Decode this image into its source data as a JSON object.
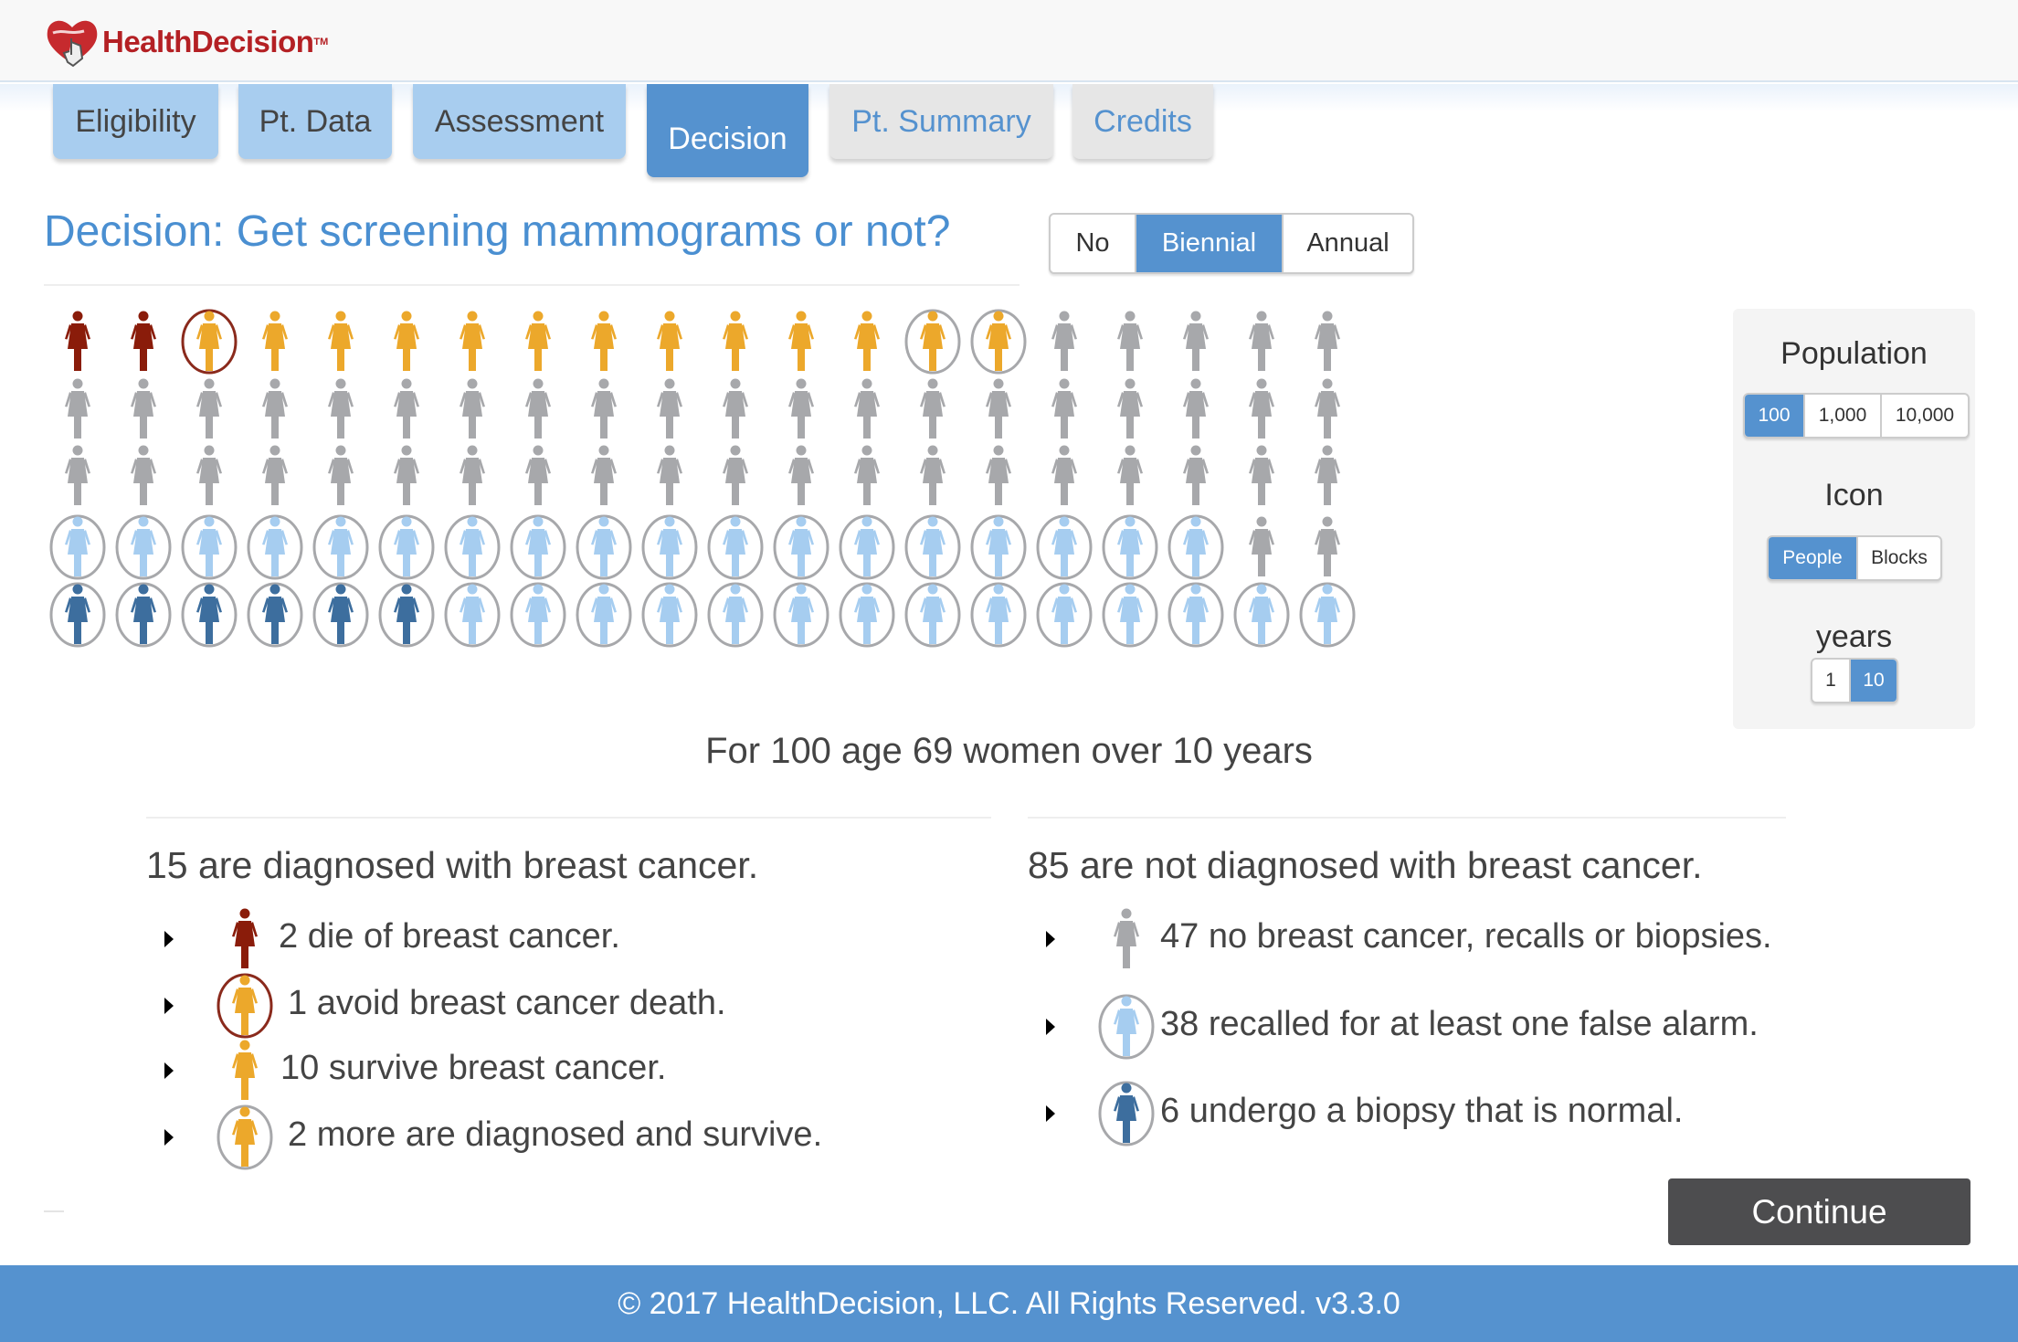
{
  "brand": {
    "name": "HealthDecision",
    "tm": "TM",
    "accent": "#b42024"
  },
  "tabs": [
    {
      "label": "Eligibility",
      "state": "done"
    },
    {
      "label": "Pt. Data",
      "state": "done"
    },
    {
      "label": "Assessment",
      "state": "done"
    },
    {
      "label": "Decision",
      "state": "active"
    },
    {
      "label": "Pt. Summary",
      "state": "future"
    },
    {
      "label": "Credits",
      "state": "future"
    }
  ],
  "decision": {
    "title": "Decision: Get screening mammograms or not?",
    "options": [
      {
        "label": "No",
        "selected": false
      },
      {
        "label": "Biennial",
        "selected": true
      },
      {
        "label": "Annual",
        "selected": false
      }
    ]
  },
  "controls": {
    "population_label": "Population",
    "population_options": [
      {
        "label": "100",
        "selected": true
      },
      {
        "label": "1,000",
        "selected": false
      },
      {
        "label": "10,000",
        "selected": false
      }
    ],
    "icon_label": "Icon",
    "icon_options": [
      {
        "label": "People",
        "selected": true
      },
      {
        "label": "Blocks",
        "selected": false
      }
    ],
    "years_label": "years",
    "years_options": [
      {
        "label": "1",
        "selected": false
      },
      {
        "label": "10",
        "selected": true
      }
    ]
  },
  "colors": {
    "die": "#8a1c0a",
    "survive": "#eca82b",
    "none": "#a7a8ab",
    "recall": "#a6cdf0",
    "biopsy": "#3d6e9e",
    "ring_gray": "#a7a8ab",
    "ring_red": "#8a2a1c",
    "primary": "#5592cf"
  },
  "icon_array": {
    "columns": 20,
    "rows": [
      [
        "die",
        "die",
        "avoid",
        "survive",
        "survive",
        "survive",
        "survive",
        "survive",
        "survive",
        "survive",
        "survive",
        "survive",
        "survive",
        "more",
        "more",
        "none",
        "none",
        "none",
        "none",
        "none"
      ],
      [
        "none",
        "none",
        "none",
        "none",
        "none",
        "none",
        "none",
        "none",
        "none",
        "none",
        "none",
        "none",
        "none",
        "none",
        "none",
        "none",
        "none",
        "none",
        "none",
        "none"
      ],
      [
        "none",
        "none",
        "none",
        "none",
        "none",
        "none",
        "none",
        "none",
        "none",
        "none",
        "none",
        "none",
        "none",
        "none",
        "none",
        "none",
        "none",
        "none",
        "none",
        "none"
      ],
      [
        "recall",
        "recall",
        "recall",
        "recall",
        "recall",
        "recall",
        "recall",
        "recall",
        "recall",
        "recall",
        "recall",
        "recall",
        "recall",
        "recall",
        "recall",
        "recall",
        "recall",
        "recall",
        "none",
        "none"
      ],
      [
        "biopsy",
        "biopsy",
        "biopsy",
        "biopsy",
        "biopsy",
        "biopsy",
        "recall",
        "recall",
        "recall",
        "recall",
        "recall",
        "recall",
        "recall",
        "recall",
        "recall",
        "recall",
        "recall",
        "recall",
        "recall",
        "recall"
      ]
    ]
  },
  "caption": "For 100 age 69 women over 10 years",
  "diagnosed": {
    "heading": "15 are diagnosed with breast cancer.",
    "items": [
      {
        "type": "die",
        "text": "2 die of breast cancer."
      },
      {
        "type": "avoid",
        "text": "1 avoid breast cancer death."
      },
      {
        "type": "survive",
        "text": "10 survive breast cancer."
      },
      {
        "type": "more",
        "text": "2 more are diagnosed and survive."
      }
    ]
  },
  "not_diagnosed": {
    "heading": "85 are not diagnosed with breast cancer.",
    "items": [
      {
        "type": "none",
        "text": "47 no breast cancer, recalls or biopsies."
      },
      {
        "type": "recall",
        "text": "38 recalled for at least one false alarm."
      },
      {
        "type": "biopsy",
        "text": "6 undergo a biopsy that is normal."
      }
    ]
  },
  "continue_label": "Continue",
  "footer": "© 2017 HealthDecision, LLC. All Rights Reserved. v3.3.0"
}
